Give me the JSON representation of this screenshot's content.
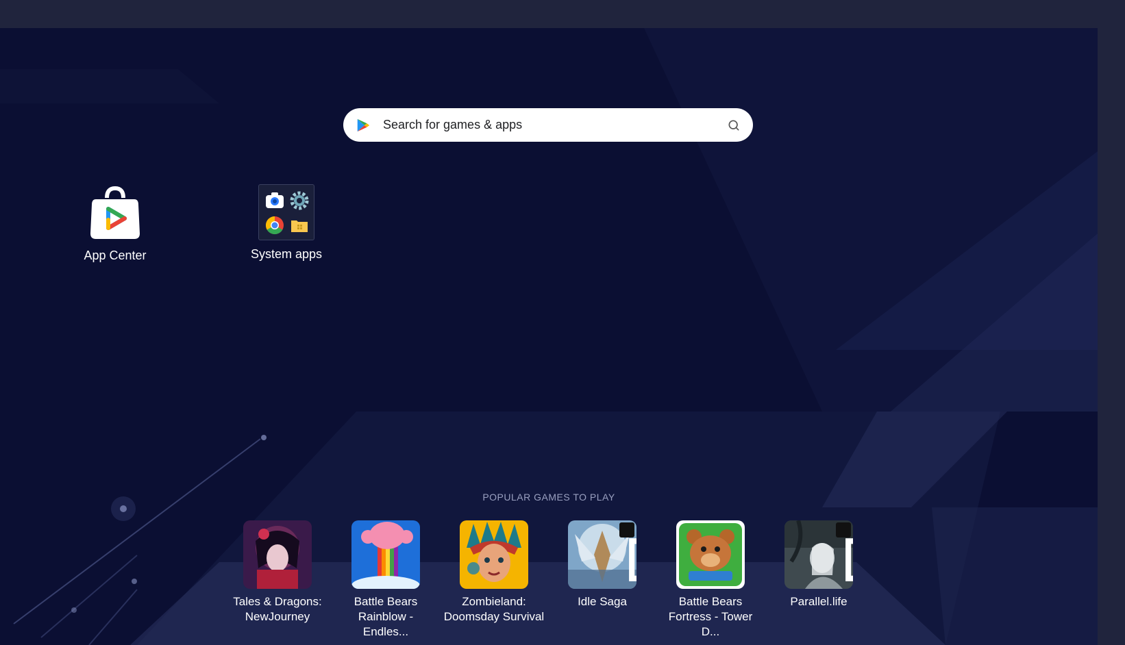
{
  "search": {
    "placeholder": "Search for games & apps",
    "play_icon": "google-play-icon",
    "search_icon": "magnifier-icon"
  },
  "desktop_icons": [
    {
      "label": "App Center",
      "icon": "app-center-bag-icon"
    },
    {
      "label": "System apps",
      "icon": "folder-icon"
    }
  ],
  "system_apps_folder": [
    "camera-icon",
    "settings-gear-icon",
    "chrome-icon",
    "file-manager-icon"
  ],
  "popular": {
    "title": "POPULAR GAMES TO PLAY",
    "games": [
      {
        "line1": "Tales & Dragons:",
        "line2": "NewJourney",
        "external": false
      },
      {
        "line1": "Battle Bears",
        "line2": "Rainblow - Endles...",
        "external": false
      },
      {
        "line1": "Zombieland:",
        "line2": "Doomsday Survival",
        "external": false
      },
      {
        "line1": "Idle Saga",
        "line2": "",
        "external": true
      },
      {
        "line1": "Battle Bears",
        "line2": "Fortress - Tower D...",
        "external": false
      },
      {
        "line1": "Parallel.life",
        "line2": "",
        "external": true
      }
    ]
  },
  "colors": {
    "desktop_bg": "#0b0f33",
    "frame": "#20243d",
    "text": "#ffffff",
    "section_title": "#9aa0c0"
  }
}
